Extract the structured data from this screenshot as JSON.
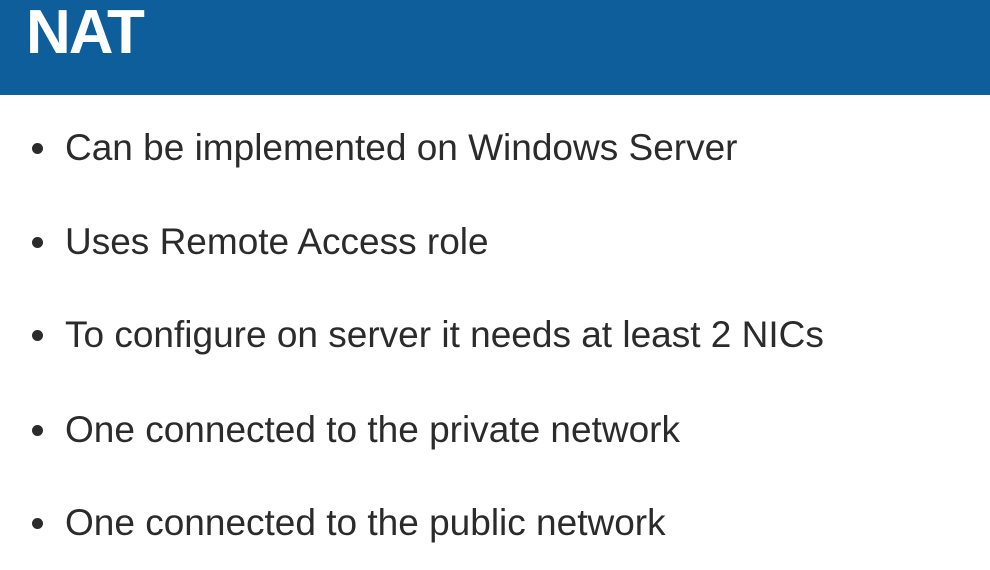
{
  "slide": {
    "title": "NAT",
    "bullets": [
      "Can be implemented on Windows Server",
      "Uses Remote Access role",
      "To configure on server it needs at least 2 NICs",
      "One connected to the private network",
      "One connected to the public network"
    ]
  },
  "colors": {
    "title_bar": "#0e5e9c",
    "title_text": "#ffffff",
    "body_text": "#2b2b2b",
    "background": "#ffffff"
  }
}
